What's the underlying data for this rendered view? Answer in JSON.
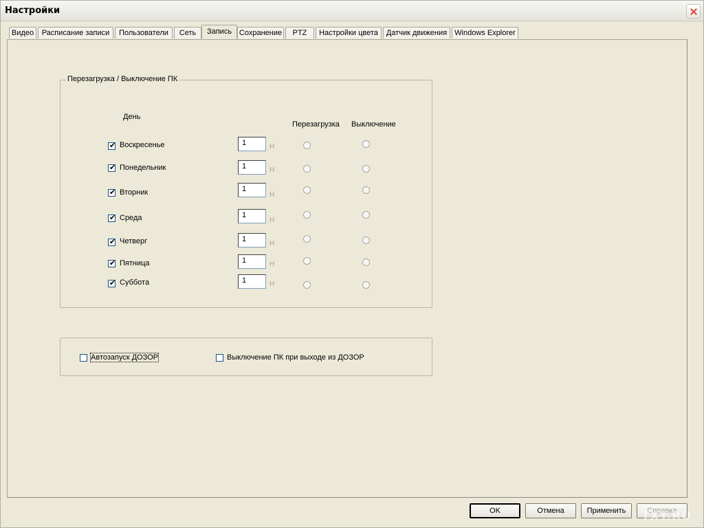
{
  "window": {
    "title": "Настройки"
  },
  "tabs": [
    {
      "label": "Видео"
    },
    {
      "label": "Расписание записи"
    },
    {
      "label": "Пользователи"
    },
    {
      "label": "Сеть"
    },
    {
      "label": "Запись",
      "active": true
    },
    {
      "label": "Сохранение"
    },
    {
      "label": "PTZ"
    },
    {
      "label": "Настройки цвета"
    },
    {
      "label": "Датчик движения"
    },
    {
      "label": "Windows Explorer"
    }
  ],
  "reboot_group": {
    "title": "Перезагрузка / Выключение ПК",
    "col_day": "День",
    "col_reboot": "Перезагрузка",
    "col_shutdown": "Выключение",
    "unit": "Н",
    "days": [
      {
        "label": "Воскресенье",
        "checked": true,
        "value": "1"
      },
      {
        "label": "Понедельник",
        "checked": true,
        "value": "1"
      },
      {
        "label": "Вторник",
        "checked": true,
        "value": "1"
      },
      {
        "label": "Среда",
        "checked": true,
        "value": "1"
      },
      {
        "label": "Четверг",
        "checked": true,
        "value": "1"
      },
      {
        "label": "Пятница",
        "checked": true,
        "value": "1"
      },
      {
        "label": "Суббота",
        "checked": true,
        "value": "1"
      }
    ]
  },
  "options_group": {
    "autostart": {
      "label": "Автозапуск ДОЗОР",
      "checked": false
    },
    "shutdown_on_exit": {
      "label": "Выключение ПК при выходе из ДОЗОР",
      "checked": false
    }
  },
  "buttons": {
    "ok": "OK",
    "cancel": "Отмена",
    "apply": "Применить",
    "help": "Справка"
  },
  "watermark": "TXT.RU"
}
